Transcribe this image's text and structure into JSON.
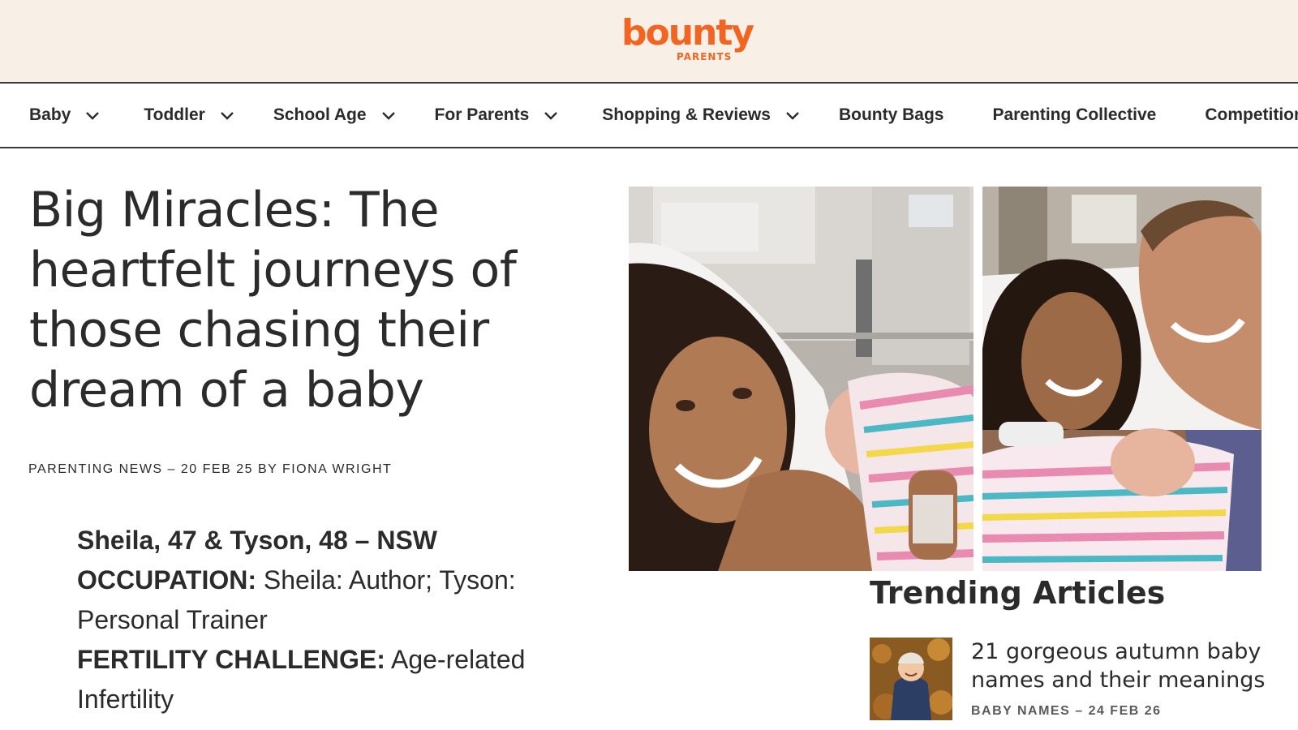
{
  "brand": {
    "name": "bounty",
    "sub": "PARENTS",
    "color": "#f26422"
  },
  "nav": {
    "items": [
      {
        "label": "Baby",
        "has_dropdown": true
      },
      {
        "label": "Toddler",
        "has_dropdown": true
      },
      {
        "label": "School Age",
        "has_dropdown": true
      },
      {
        "label": "For Parents",
        "has_dropdown": true
      },
      {
        "label": "Shopping & Reviews",
        "has_dropdown": true
      },
      {
        "label": "Bounty Bags",
        "has_dropdown": false
      },
      {
        "label": "Parenting Collective",
        "has_dropdown": false
      },
      {
        "label": "Competitions",
        "has_dropdown": false
      }
    ]
  },
  "article": {
    "title": "Big Miracles: The heartfelt journeys of those chasing their dream of a baby",
    "meta": "PARENTING NEWS – 20 FEB 25 BY FIONA WRIGHT",
    "profile": {
      "heading": "Sheila, 47 & Tyson, 48 – NSW",
      "occupation_label": "OCCUPATION:",
      "occupation_value": "Sheila: Author; Tyson: Personal Trainer",
      "challenge_label": "FERTILITY CHALLENGE:",
      "challenge_value": "Age-related Infertility"
    }
  },
  "trending": {
    "title": "Trending Articles",
    "items": [
      {
        "headline": "21 gorgeous autumn baby names and their meanings",
        "meta": "BABY NAMES – 24 FEB 26"
      }
    ]
  }
}
